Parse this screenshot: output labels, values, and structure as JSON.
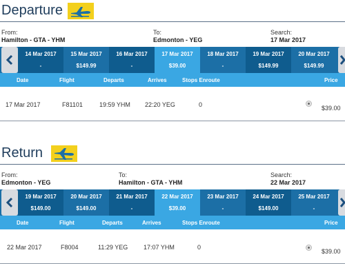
{
  "departure": {
    "title": "Departure",
    "from_label": "From:",
    "from_value": "Hamilton - GTA - YHM",
    "to_label": "To:",
    "to_value": "Edmonton - YEG",
    "search_label": "Search:",
    "search_value": "17 Mar 2017",
    "days": [
      {
        "date": "14 Mar 2017",
        "price": "-"
      },
      {
        "date": "15 Mar 2017",
        "price": "$149.99"
      },
      {
        "date": "16 Mar 2017",
        "price": "-"
      },
      {
        "date": "17 Mar 2017",
        "price": "$39.00"
      },
      {
        "date": "18 Mar 2017",
        "price": "-"
      },
      {
        "date": "19 Mar 2017",
        "price": "$149.99"
      },
      {
        "date": "20 Mar 2017",
        "price": "$149.99"
      }
    ],
    "headers": {
      "date": "Date",
      "flight": "Flight",
      "departs": "Departs",
      "arrives": "Arrives",
      "stops": "Stops Enroute",
      "price": "Price"
    },
    "flight": {
      "date": "17 Mar 2017",
      "flight": "F81101",
      "departs": "19:59 YHM",
      "arrives": "22:20 YEG",
      "stops": "0",
      "price": "$39.00"
    }
  },
  "return": {
    "title": "Return",
    "from_label": "From:",
    "from_value": "Edmonton - YEG",
    "to_label": "To:",
    "to_value": "Hamilton - GTA - YHM",
    "search_label": "Search:",
    "search_value": "22 Mar 2017",
    "days": [
      {
        "date": "19 Mar 2017",
        "price": "$149.00"
      },
      {
        "date": "20 Mar 2017",
        "price": "$149.00"
      },
      {
        "date": "21 Mar 2017",
        "price": "-"
      },
      {
        "date": "22 Mar 2017",
        "price": "$39.00"
      },
      {
        "date": "23 Mar 2017",
        "price": "-"
      },
      {
        "date": "24 Mar 2017",
        "price": "$149.00"
      },
      {
        "date": "25 Mar 2017",
        "price": "-"
      }
    ],
    "headers": {
      "date": "Date",
      "flight": "Flight",
      "departs": "Departs",
      "arrives": "Arrives",
      "stops": "Stops Enroute",
      "price": "Price"
    },
    "flight": {
      "date": "22 Mar 2017",
      "flight": "F8004",
      "departs": "11:29 YEG",
      "arrives": "17:07 YHM",
      "stops": "0",
      "price": "$39.00"
    }
  },
  "icons": {
    "badge": "plane-icon",
    "prev": "chevron-left-icon",
    "next": "chevron-right-icon"
  },
  "colors": {
    "accent": "#1c6fa6",
    "selected": "#3aa7e3",
    "dark_day": "#0f5c8e",
    "badge": "#f3d01d",
    "title": "#1f3d5c"
  }
}
